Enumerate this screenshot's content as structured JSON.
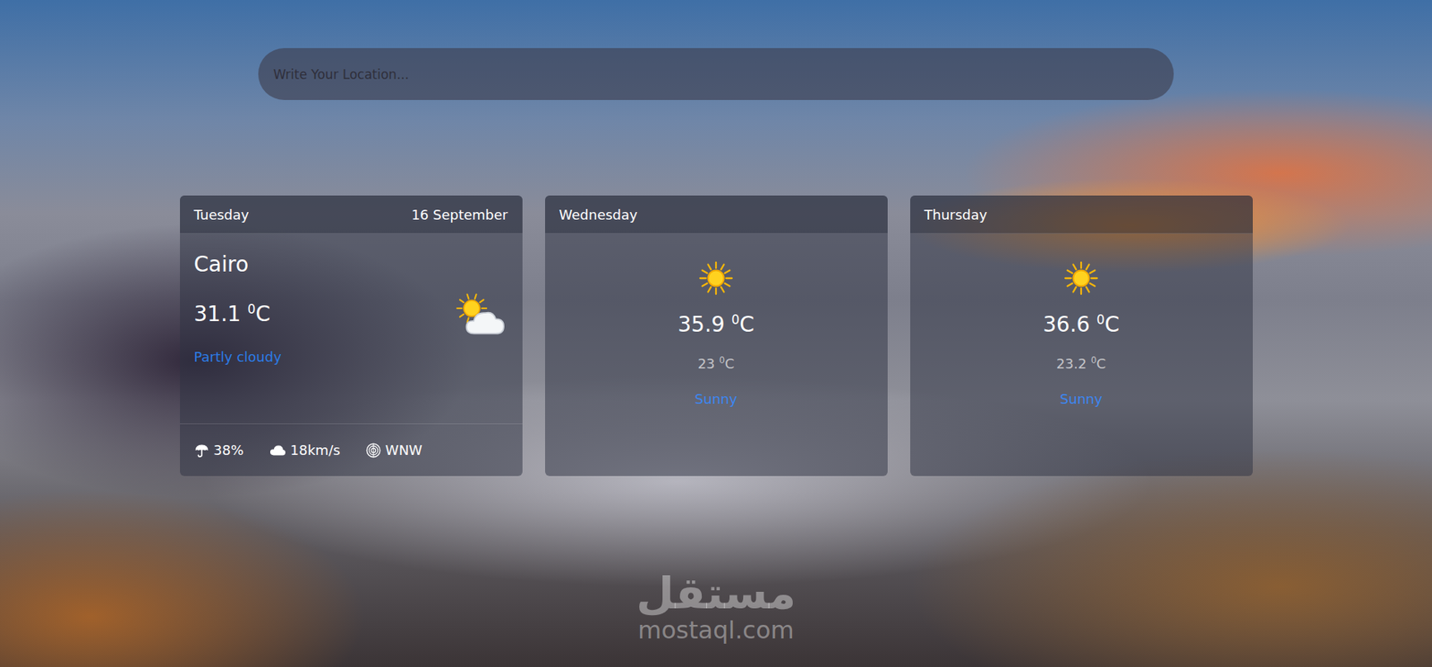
{
  "search": {
    "placeholder": "Write Your Location..."
  },
  "today": {
    "day": "Tuesday",
    "date": "16 September",
    "city": "Cairo",
    "temp": {
      "value": "31.1",
      "degree": "0",
      "unit": "C"
    },
    "kind": "sun-cloud",
    "condition": "Partly cloudy",
    "stats": [
      {
        "kind": "rain",
        "value": "38%"
      },
      {
        "kind": "wind",
        "value": "18km/s"
      },
      {
        "kind": "direction",
        "value": "WNW"
      }
    ]
  },
  "forecast": [
    {
      "day": "Wednesday",
      "kind": "sun",
      "max": {
        "value": "35.9",
        "degree": "0",
        "unit": "C"
      },
      "min": {
        "value": "23",
        "degree": "0",
        "unit": "C"
      },
      "condition": "Sunny"
    },
    {
      "day": "Thursday",
      "kind": "sun",
      "max": {
        "value": "36.6",
        "degree": "0",
        "unit": "C"
      },
      "min": {
        "value": "23.2",
        "degree": "0",
        "unit": "C"
      },
      "condition": "Sunny"
    }
  ],
  "watermark": {
    "brand": "مستقل",
    "site": "mostaql.com"
  }
}
